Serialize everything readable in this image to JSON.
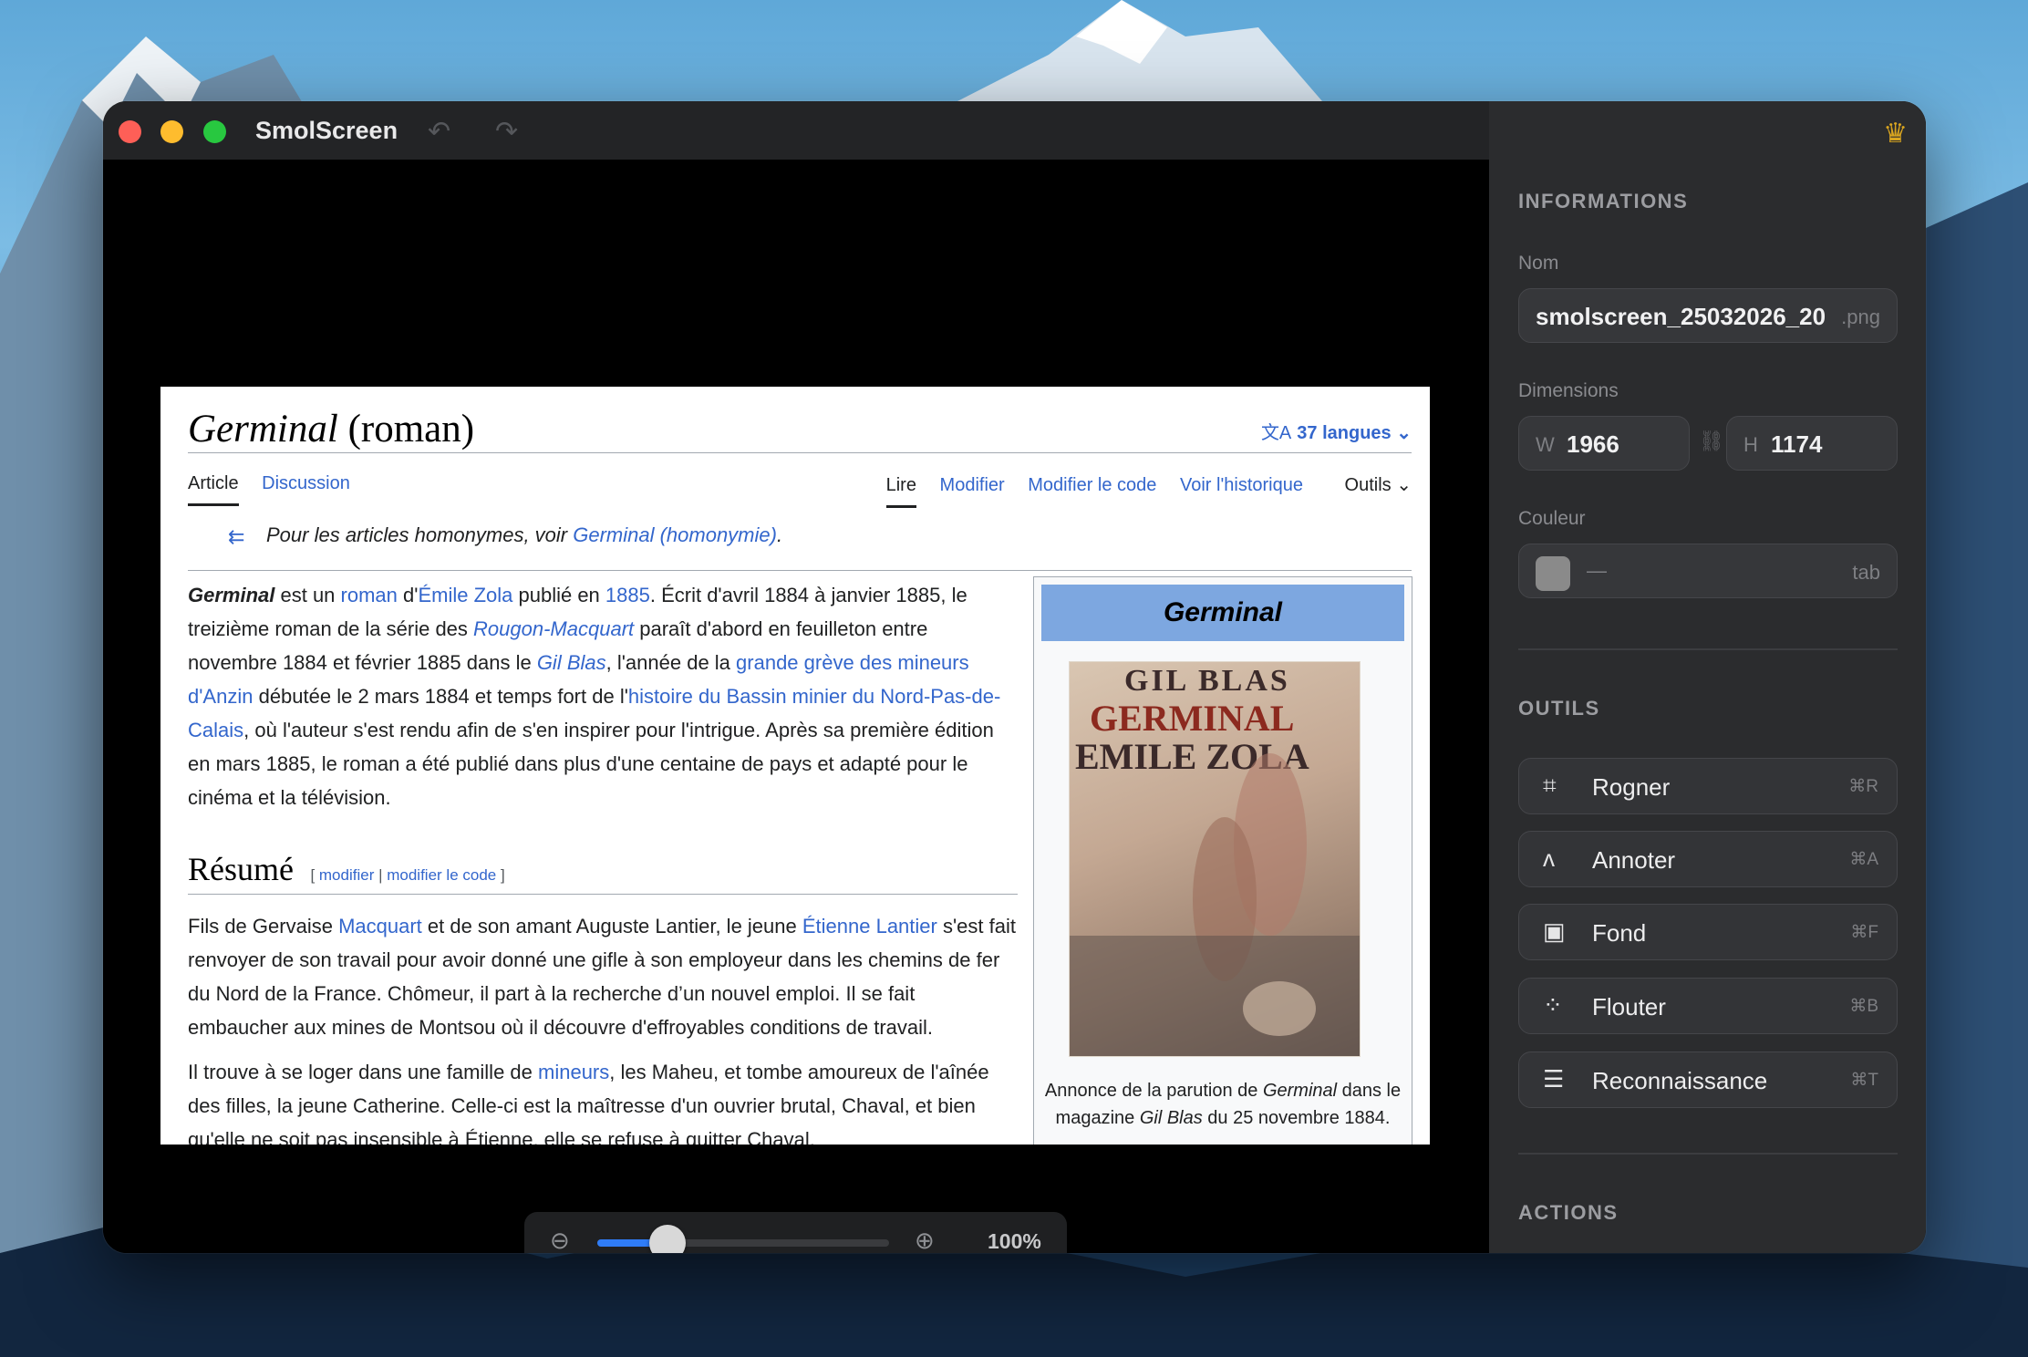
{
  "app": {
    "title": "SmolScreen"
  },
  "wiki": {
    "title_italic": "Germinal",
    "title_rest": " (roman)",
    "langs": "37 langues",
    "tab_article": "Article",
    "tab_discussion": "Discussion",
    "action_read": "Lire",
    "action_edit": "Modifier",
    "action_edit_code": "Modifier le code",
    "action_history": "Voir l'historique",
    "action_tools": "Outils",
    "hatnote_prefix": "Pour les articles homonymes, voir ",
    "hatnote_link": "Germinal (homonymie)",
    "hatnote_suffix": ".",
    "intro": {
      "germinal": "Germinal",
      "t1": " est un ",
      "roman": "roman",
      "t2": " d'",
      "zola": "Émile Zola",
      "t3": " publié en ",
      "year": "1885",
      "t4": ". Écrit d'avril 1884 à janvier 1885, le treizième roman de la série des ",
      "rougon": "Rougon-Macquart",
      "t5": " paraît d'abord en feuilleton entre novembre 1884 et février 1885 dans le ",
      "gilblas": "Gil Blas",
      "t6": ", l'année de la ",
      "greve": "grande grève des mineurs d'Anzin",
      "t7": " débutée le 2 mars 1884 et temps fort de l'",
      "bassin": "histoire du Bassin minier du Nord-Pas-de-Calais",
      "t8": ", où l'auteur s'est rendu afin de s'en inspirer pour l'intrigue. Après sa première édition en mars 1885, le roman a été publié dans plus d'une centaine de pays et adapté pour le cinéma et la télévision."
    },
    "resume_title": "Résumé",
    "resume_edit_open": "[ ",
    "resume_edit": "modifier",
    "resume_sep": " | ",
    "resume_edit_code": "modifier le code",
    "resume_edit_close": " ]",
    "p2": {
      "t1": "Fils de Gervaise ",
      "macquart": "Macquart",
      "t2": " et de son amant Auguste Lantier, le jeune ",
      "etienne": "Étienne Lantier",
      "t3": " s'est fait renvoyer de son travail pour avoir donné une gifle à son employeur dans les chemins de fer du Nord de la France. Chômeur, il part à la recherche d’un nouvel emploi. Il se fait embaucher aux mines de Montsou où il découvre d'effroyables conditions de travail."
    },
    "p3": {
      "t1": "Il trouve à se loger dans une famille de ",
      "mineurs": "mineurs",
      "t2": ", les Maheu, et tombe amoureux de l'aînée des filles, la jeune Catherine. Celle-ci est la maîtresse d'un ouvrier brutal, Chaval, et bien qu'elle ne soit pas insensible à Étienne, elle se refuse à quitter Chaval."
    },
    "infobox": {
      "title": "Germinal",
      "poster_line1": "GIL BLAS",
      "poster_line2": "GERMINAL",
      "poster_line3": "EMILE ZOLA",
      "caption_1": "Annonce de la parution de ",
      "caption_germinal": "Germinal",
      "caption_2": " dans le magazine ",
      "caption_gilblas": "Gil Blas",
      "caption_3": " du 25 novembre 1884."
    }
  },
  "zoom": {
    "label": "100%",
    "level": 0.24
  },
  "sidebar": {
    "informations": "INFORMATIONS",
    "nom_label": "Nom",
    "nom_value": "smolscreen_25032026_20",
    "nom_ext": ".png",
    "dimensions_label": "Dimensions",
    "w_prefix": "W",
    "w_value": "1966",
    "h_prefix": "H",
    "h_value": "1174",
    "couleur_label": "Couleur",
    "couleur_value": "—",
    "couleur_hint": "tab",
    "swatch_color": "#8a8a8a",
    "outils": "OUTILS",
    "tools": [
      {
        "label": "Rogner",
        "shortcut": "⌘R",
        "icon": "crop-icon"
      },
      {
        "label": "Annoter",
        "shortcut": "⌘A",
        "icon": "pen-icon"
      },
      {
        "label": "Fond",
        "shortcut": "⌘F",
        "icon": "image-icon"
      },
      {
        "label": "Flouter",
        "shortcut": "⌘B",
        "icon": "blur-icon"
      },
      {
        "label": "Reconnaissance",
        "shortcut": "⌘T",
        "icon": "text-recognition-icon"
      }
    ],
    "actions": "ACTIONS"
  },
  "colors": {
    "accent": "#2f7cf6",
    "link": "#3366cc",
    "crown": "#d9a520"
  }
}
